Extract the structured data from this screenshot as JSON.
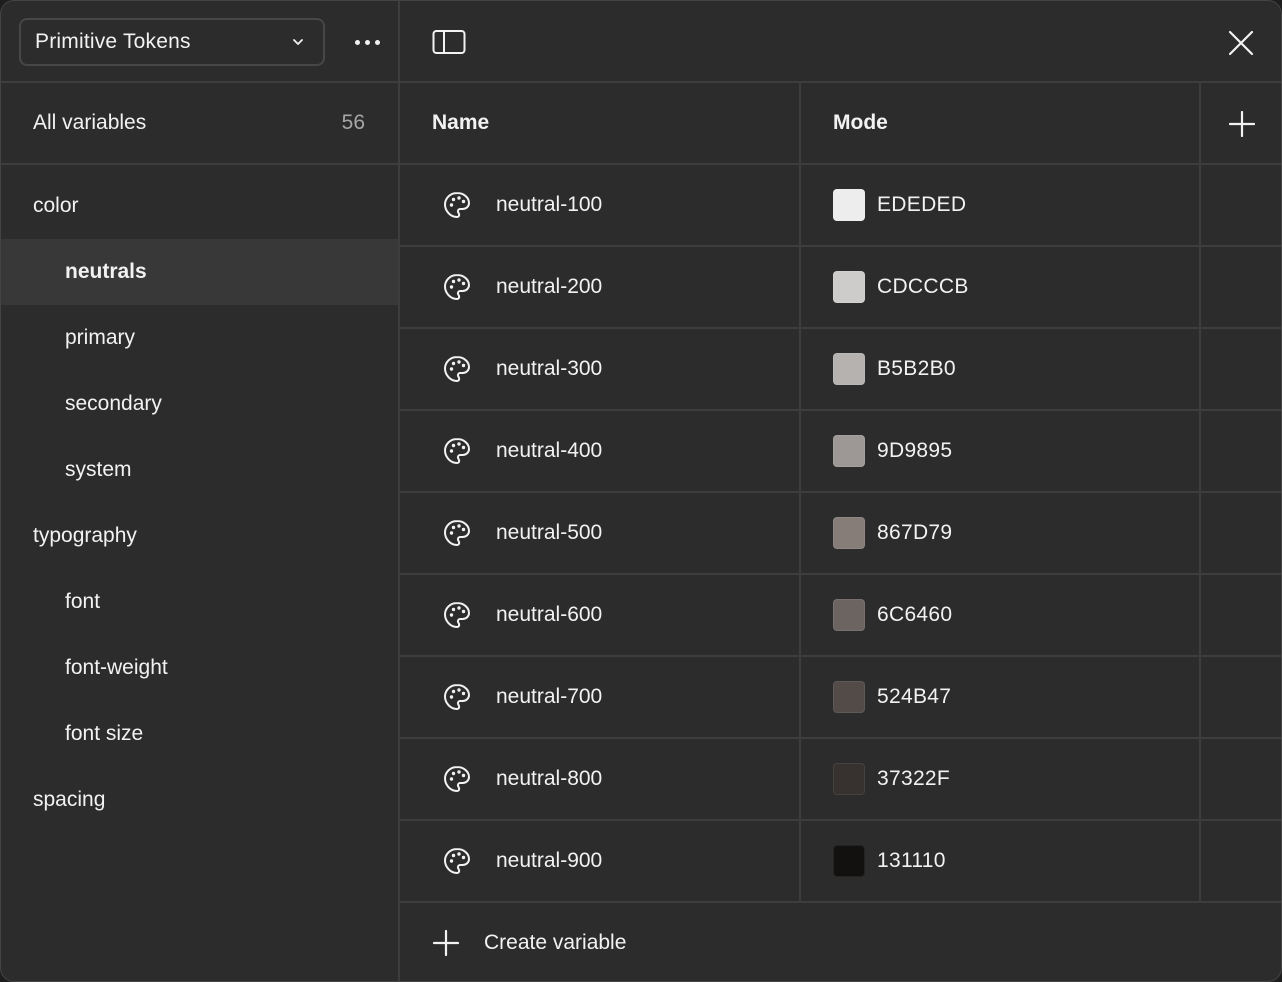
{
  "sidebar": {
    "collection_label": "Primitive Tokens",
    "all_variables_label": "All variables",
    "all_variables_count": "56",
    "groups": [
      {
        "label": "color",
        "level": 0,
        "selected": false
      },
      {
        "label": "neutrals",
        "level": 1,
        "selected": true
      },
      {
        "label": "primary",
        "level": 1,
        "selected": false
      },
      {
        "label": "secondary",
        "level": 1,
        "selected": false
      },
      {
        "label": "system",
        "level": 1,
        "selected": false
      },
      {
        "label": "typography",
        "level": 0,
        "selected": false
      },
      {
        "label": "font",
        "level": 1,
        "selected": false
      },
      {
        "label": "font-weight",
        "level": 1,
        "selected": false
      },
      {
        "label": "font size",
        "level": 1,
        "selected": false
      },
      {
        "label": "spacing",
        "level": 0,
        "selected": false
      }
    ]
  },
  "table": {
    "header_name": "Name",
    "header_mode": "Mode",
    "rows": [
      {
        "name": "neutral-100",
        "value": "EDEDED",
        "color": "#EDEDED"
      },
      {
        "name": "neutral-200",
        "value": "CDCCCB",
        "color": "#CDCCCB"
      },
      {
        "name": "neutral-300",
        "value": "B5B2B0",
        "color": "#B5B2B0"
      },
      {
        "name": "neutral-400",
        "value": "9D9895",
        "color": "#9D9895"
      },
      {
        "name": "neutral-500",
        "value": "867D79",
        "color": "#867D79"
      },
      {
        "name": "neutral-600",
        "value": "6C6460",
        "color": "#6C6460"
      },
      {
        "name": "neutral-700",
        "value": "524B47",
        "color": "#524B47"
      },
      {
        "name": "neutral-800",
        "value": "37322F",
        "color": "#37322F"
      },
      {
        "name": "neutral-900",
        "value": "131110",
        "color": "#131110"
      }
    ],
    "create_label": "Create variable"
  },
  "icons": {
    "row_icon": "palette-icon",
    "toolbar": [
      "sidebar-toggle-icon",
      "close-icon",
      "plus-icon",
      "more-icon",
      "chevron-down-icon"
    ]
  },
  "colors": {
    "background": "#2c2c2c",
    "divider": "#3d3d3d",
    "selected": "#383838",
    "text": "#f2f2f2",
    "muted": "#a6a6a6"
  }
}
